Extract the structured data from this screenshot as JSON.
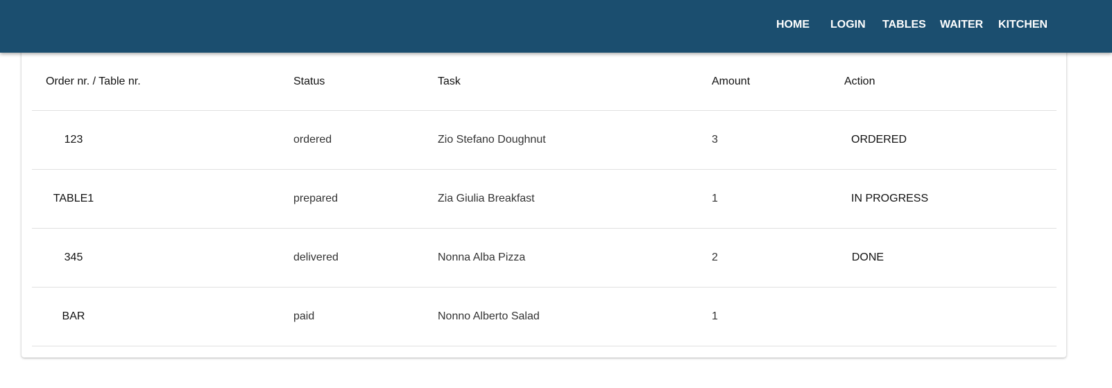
{
  "nav": {
    "items": [
      "HOME",
      "LOGIN",
      "TABLES",
      "WAITER",
      "KITCHEN"
    ]
  },
  "table": {
    "headers": [
      "Order nr. / Table nr.",
      "Status",
      "Task",
      "Amount",
      "Action"
    ],
    "rows": [
      {
        "order": "123",
        "status": "ordered",
        "task": "Zio Stefano Doughnut",
        "amount": "3",
        "action": "ORDERED"
      },
      {
        "order": "TABLE1",
        "status": "prepared",
        "task": "Zia Giulia Breakfast",
        "amount": "1",
        "action": "IN PROGRESS"
      },
      {
        "order": "345",
        "status": "delivered",
        "task": "Nonna Alba Pizza",
        "amount": "2",
        "action": "DONE"
      },
      {
        "order": "BAR",
        "status": "paid",
        "task": "Nonno Alberto Salad",
        "amount": "1",
        "action": ""
      }
    ]
  },
  "colors": {
    "appbar": "#1b4e6f"
  }
}
